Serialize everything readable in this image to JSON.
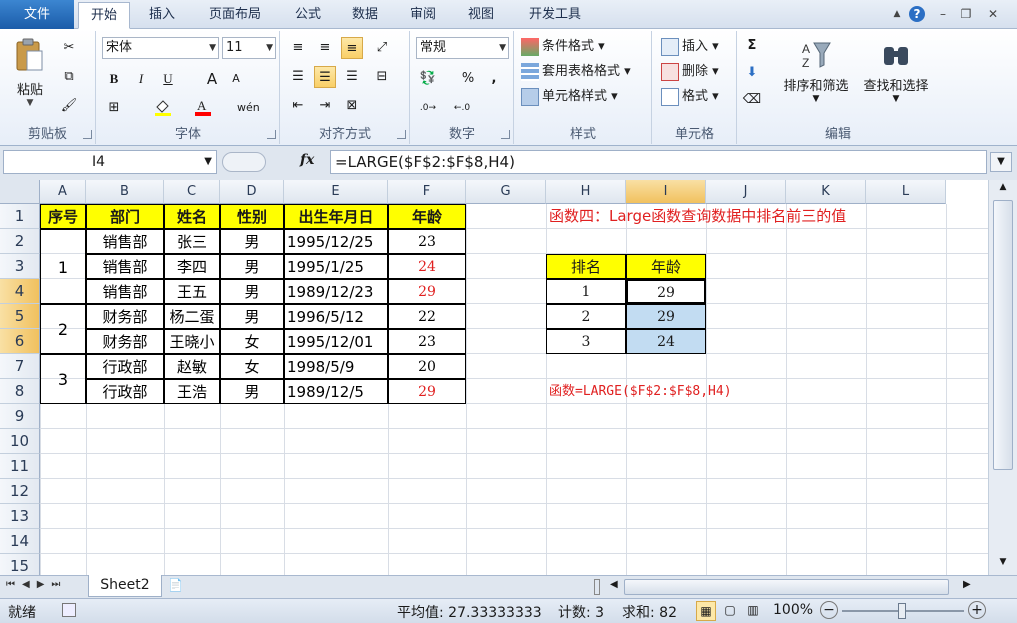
{
  "tabs": {
    "file": "文件",
    "home": "开始",
    "insert": "插入",
    "layout": "页面布局",
    "formulas": "公式",
    "data": "数据",
    "review": "审阅",
    "view": "视图",
    "developer": "开发工具"
  },
  "ribbon": {
    "clipboard": {
      "label": "剪贴板",
      "paste": "粘贴"
    },
    "font": {
      "label": "字体",
      "name": "宋体",
      "size": "11",
      "bold": "B",
      "italic": "I",
      "underline": "U",
      "grow": "A",
      "shrink": "A"
    },
    "alignment": {
      "label": "对齐方式"
    },
    "number": {
      "label": "数字",
      "format": "常规",
      "percent": "%",
      "comma": ","
    },
    "styles": {
      "label": "样式",
      "conditional": "条件格式",
      "table": "套用表格格式",
      "cell": "单元格样式"
    },
    "cells": {
      "label": "单元格",
      "insert": "插入",
      "delete": "删除",
      "format": "格式"
    },
    "editing": {
      "label": "编辑",
      "sortfilter": "排序和筛选",
      "findselect": "查找和选择"
    }
  },
  "formula_bar": {
    "name_box": "I4",
    "fx": "fx",
    "formula": "=LARGE($F$2:$F$8,H4)"
  },
  "columns": [
    "A",
    "B",
    "C",
    "D",
    "E",
    "F",
    "G",
    "H",
    "I",
    "J",
    "K",
    "L"
  ],
  "rows": [
    "1",
    "2",
    "3",
    "4",
    "5",
    "6",
    "7",
    "8",
    "9",
    "10",
    "11",
    "12",
    "13",
    "14",
    "15"
  ],
  "table": {
    "headers": [
      "序号",
      "部门",
      "姓名",
      "性别",
      "出生年月日",
      "年龄"
    ],
    "groups": [
      "1",
      "2",
      "3"
    ],
    "rows": [
      [
        "销售部",
        "张三",
        "男",
        "1995/12/25",
        "23"
      ],
      [
        "销售部",
        "李四",
        "男",
        "1995/1/25",
        "24"
      ],
      [
        "销售部",
        "王五",
        "男",
        "1989/12/23",
        "29"
      ],
      [
        "财务部",
        "杨二蛋",
        "男",
        "1996/5/12",
        "22"
      ],
      [
        "财务部",
        "王晓小",
        "女",
        "1995/12/01",
        "23"
      ],
      [
        "行政部",
        "赵敏",
        "女",
        "1998/5/9",
        "20"
      ],
      [
        "行政部",
        "王浩",
        "男",
        "1989/12/5",
        "29"
      ]
    ]
  },
  "side": {
    "title": "函数四：Large函数查询数据中排名前三的值",
    "headers": [
      "排名",
      "年龄"
    ],
    "rows": [
      [
        "1",
        "29"
      ],
      [
        "2",
        "29"
      ],
      [
        "3",
        "24"
      ]
    ],
    "formula_note": "函数=LARGE($F$2:$F$8,H4)"
  },
  "sheet_tab": "Sheet2",
  "status": {
    "ready": "就绪",
    "average": "平均值: 27.33333333",
    "count": "计数: 3",
    "sum": "求和: 82",
    "zoom": "100%"
  },
  "colors": {
    "header_fill": "#ffff00",
    "highlight_red": "#e02020",
    "selection_fill": "#c2dcf2"
  }
}
